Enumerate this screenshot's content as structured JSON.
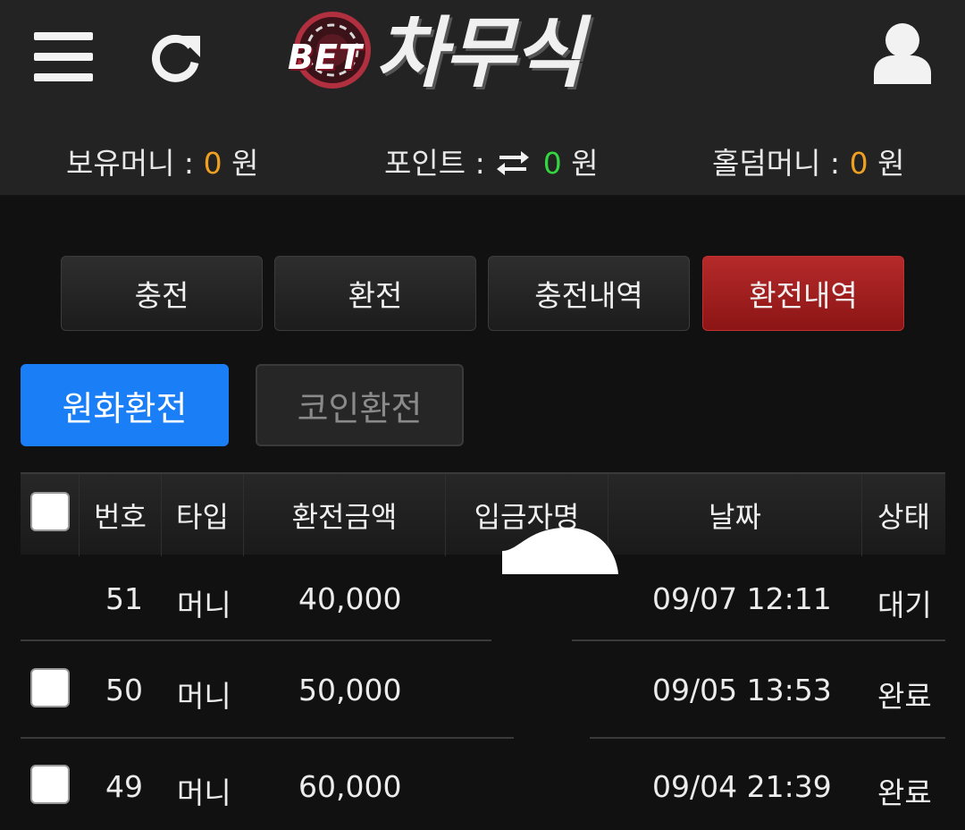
{
  "header": {
    "logo": {
      "prefix": "BET",
      "name": "차무식"
    },
    "icons": {
      "menu": "hamburger-menu-icon",
      "refresh": "refresh-icon",
      "user": "user-icon"
    }
  },
  "balances": {
    "money": {
      "label": "보유머니 :",
      "value": "0",
      "unit": "원"
    },
    "points": {
      "label": "포인트 :",
      "value": "0",
      "unit": "원"
    },
    "holdem": {
      "label": "홀덤머니 :",
      "value": "0",
      "unit": "원"
    }
  },
  "tabs": [
    {
      "label": "충전"
    },
    {
      "label": "환전"
    },
    {
      "label": "충전내역"
    },
    {
      "label": "환전내역"
    }
  ],
  "active_tab": "환전내역",
  "subtabs": [
    {
      "label": "원화환전"
    },
    {
      "label": "코인환전"
    }
  ],
  "table": {
    "headers": [
      "번호",
      "타입",
      "환전금액",
      "입금자명",
      "날짜",
      "상태"
    ],
    "rows": [
      {
        "no": "51",
        "type": "머니",
        "amount": "40,000",
        "name": "",
        "date": "09/07 12:11",
        "status": "대기"
      },
      {
        "no": "50",
        "type": "머니",
        "amount": "50,000",
        "name": "",
        "date": "09/05 13:53",
        "status": "완료"
      },
      {
        "no": "49",
        "type": "머니",
        "amount": "60,000",
        "name": "",
        "date": "09/04 21:39",
        "status": "완료"
      }
    ]
  },
  "colors": {
    "background": "#111111",
    "header": "#232323",
    "active_tab": "#a81f1f",
    "primary_button": "#1a7ef7",
    "value_orange": "#f0a020",
    "value_green": "#33d640"
  }
}
